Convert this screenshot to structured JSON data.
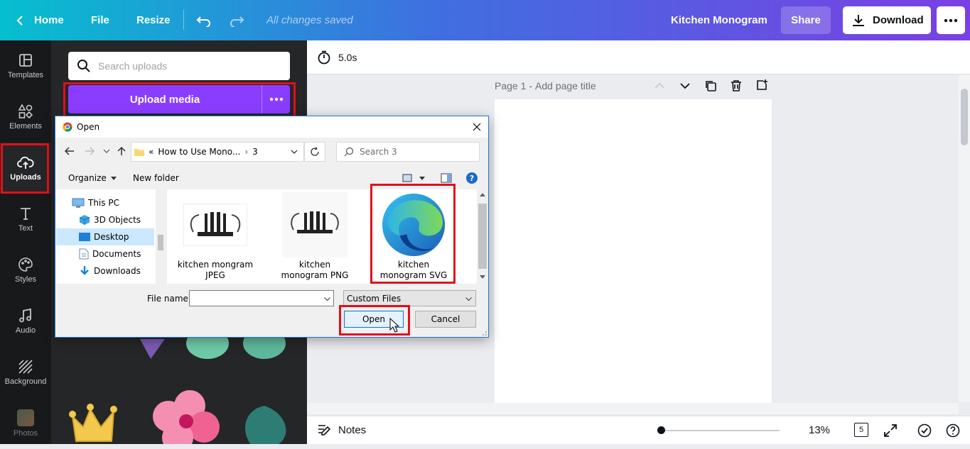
{
  "topbar": {
    "home": "Home",
    "file": "File",
    "resize": "Resize",
    "saved_status": "All changes saved",
    "doc_title": "Kitchen Monogram",
    "share": "Share",
    "download": "Download"
  },
  "rail": {
    "items": [
      {
        "label": "Templates",
        "icon": "templates-icon"
      },
      {
        "label": "Elements",
        "icon": "elements-icon"
      },
      {
        "label": "Uploads",
        "icon": "upload-cloud-icon",
        "active": true
      },
      {
        "label": "Text",
        "icon": "text-icon"
      },
      {
        "label": "Styles",
        "icon": "palette-icon"
      },
      {
        "label": "Audio",
        "icon": "music-note-icon"
      },
      {
        "label": "Background",
        "icon": "background-pattern-icon"
      },
      {
        "label": "Photos",
        "icon": "photos-icon"
      }
    ]
  },
  "panel": {
    "search_placeholder": "Search uploads",
    "upload_label": "Upload media"
  },
  "canvas": {
    "duration": "5.0s",
    "page_label": "Page 1",
    "page_title_placeholder": "Add page title"
  },
  "bottom": {
    "notes": "Notes",
    "zoom": "13%",
    "page_count": "5"
  },
  "dialog": {
    "title": "Open",
    "path_prefix": "«",
    "path_parent": "How to Use Mono...",
    "path_current": "3",
    "search_placeholder": "Search 3",
    "organize": "Organize",
    "new_folder": "New folder",
    "nav": [
      "This PC",
      "3D Objects",
      "Desktop",
      "Documents",
      "Downloads"
    ],
    "nav_selected": "Desktop",
    "files": [
      {
        "name": "kitchen mongram JPEG"
      },
      {
        "name": "kitchen monogram PNG"
      },
      {
        "name": "kitchen monogram SVG"
      }
    ],
    "file_name_label": "File name:",
    "file_name_value": "",
    "file_type": "Custom Files",
    "open": "Open",
    "cancel": "Cancel"
  },
  "colors": {
    "brand_purple": "#8b3dff",
    "highlight_red": "#e0101b",
    "rail_bg": "#18191b",
    "panel_bg": "#252627"
  }
}
